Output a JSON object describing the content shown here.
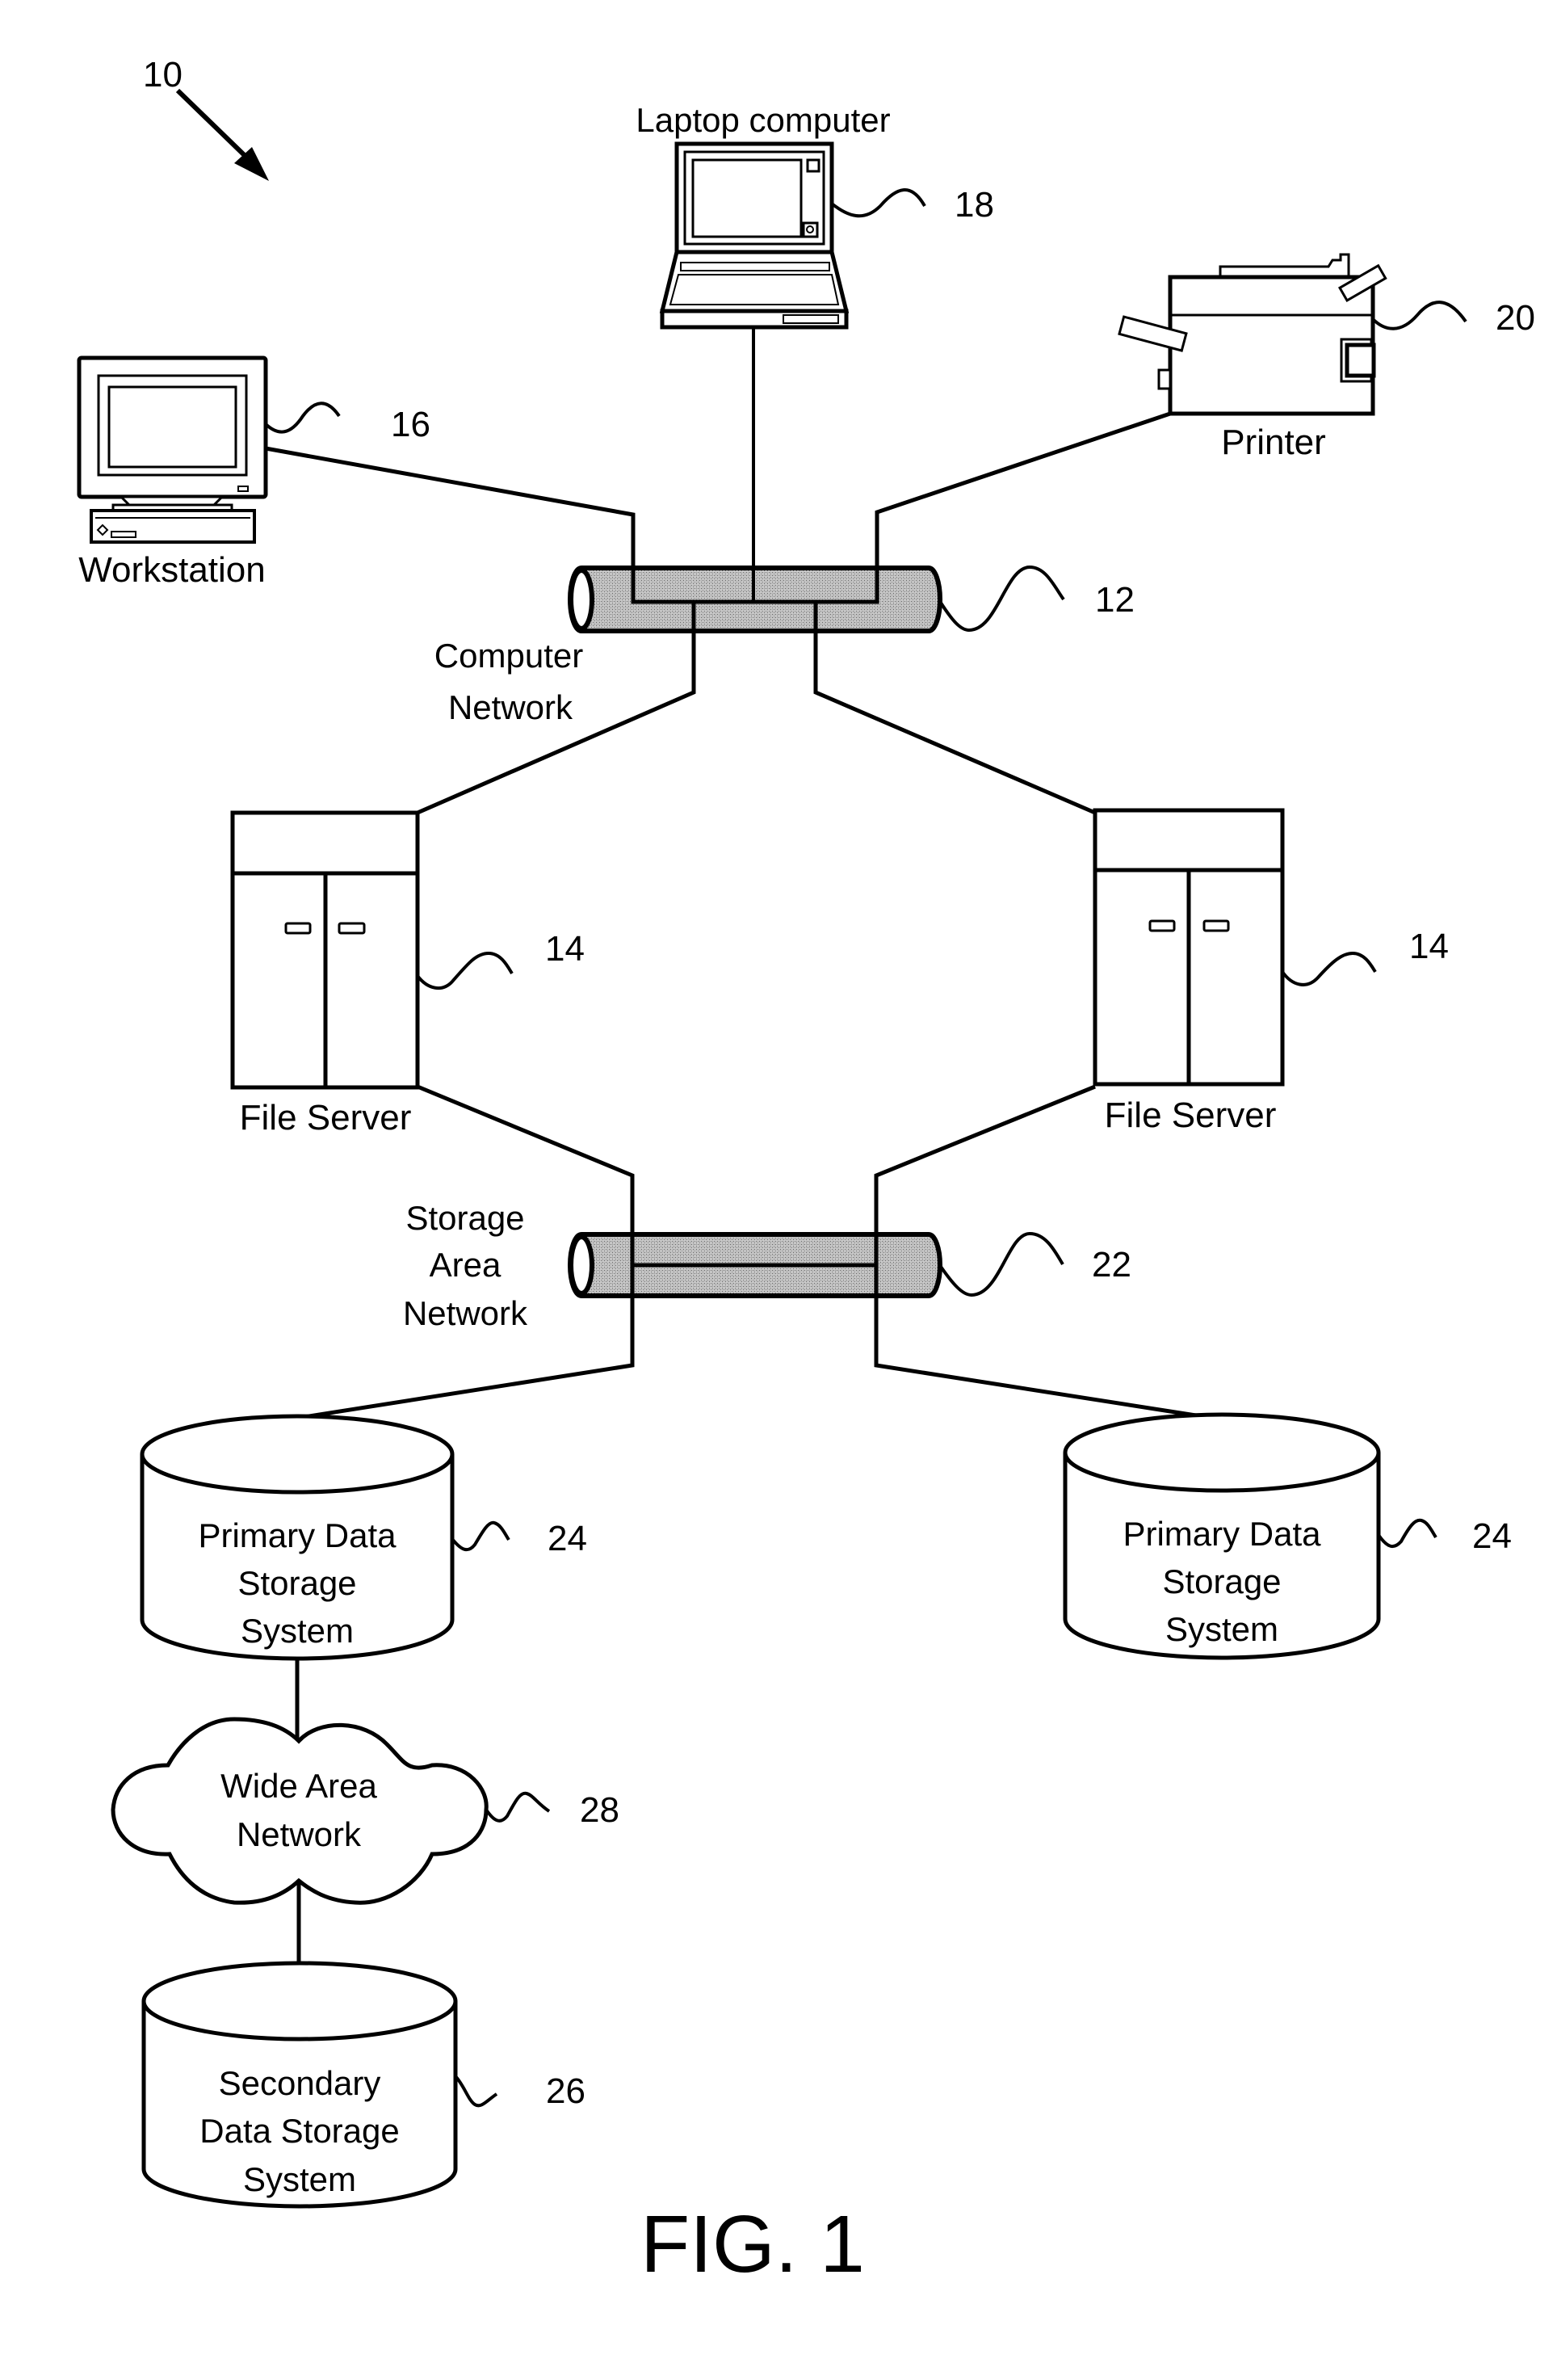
{
  "figure": {
    "title": "FIG. 1",
    "system_ref": "10"
  },
  "colors": {
    "ink": "#000000",
    "paper": "#ffffff",
    "pipe_shade": "#b8b8b8"
  },
  "nodes": {
    "laptop": {
      "label": "Laptop computer",
      "ref": "18",
      "icon": "laptop-icon"
    },
    "workstation": {
      "label": "Workstation",
      "ref": "16",
      "icon": "desktop-computer-icon"
    },
    "printer": {
      "label": "Printer",
      "ref": "20",
      "icon": "printer-icon"
    },
    "computer_network": {
      "label_lines": [
        "Computer",
        "Network"
      ],
      "ref": "12",
      "icon": "network-pipe-icon"
    },
    "file_server_left": {
      "label": "File Server",
      "ref": "14",
      "icon": "server-cabinet-icon"
    },
    "file_server_right": {
      "label": "File Server",
      "ref": "14",
      "icon": "server-cabinet-icon"
    },
    "storage_area_network": {
      "label_lines": [
        "Storage",
        "Area",
        "Network"
      ],
      "ref": "22",
      "icon": "network-pipe-icon"
    },
    "primary_storage_left": {
      "label_lines": [
        "Primary Data",
        "Storage",
        "System"
      ],
      "ref": "24",
      "icon": "database-cylinder-icon"
    },
    "primary_storage_right": {
      "label_lines": [
        "Primary Data",
        "Storage",
        "System"
      ],
      "ref": "24",
      "icon": "database-cylinder-icon"
    },
    "wide_area_network": {
      "label_lines": [
        "Wide Area",
        "Network"
      ],
      "ref": "28",
      "icon": "cloud-icon"
    },
    "secondary_storage": {
      "label_lines": [
        "Secondary",
        "Data Storage",
        "System"
      ],
      "ref": "26",
      "icon": "database-cylinder-icon"
    }
  },
  "connections": [
    [
      "workstation",
      "computer_network"
    ],
    [
      "laptop",
      "computer_network"
    ],
    [
      "printer",
      "computer_network"
    ],
    [
      "computer_network",
      "file_server_left"
    ],
    [
      "computer_network",
      "file_server_right"
    ],
    [
      "file_server_left",
      "storage_area_network"
    ],
    [
      "file_server_right",
      "storage_area_network"
    ],
    [
      "storage_area_network",
      "primary_storage_left"
    ],
    [
      "storage_area_network",
      "primary_storage_right"
    ],
    [
      "primary_storage_left",
      "wide_area_network"
    ],
    [
      "wide_area_network",
      "secondary_storage"
    ]
  ]
}
